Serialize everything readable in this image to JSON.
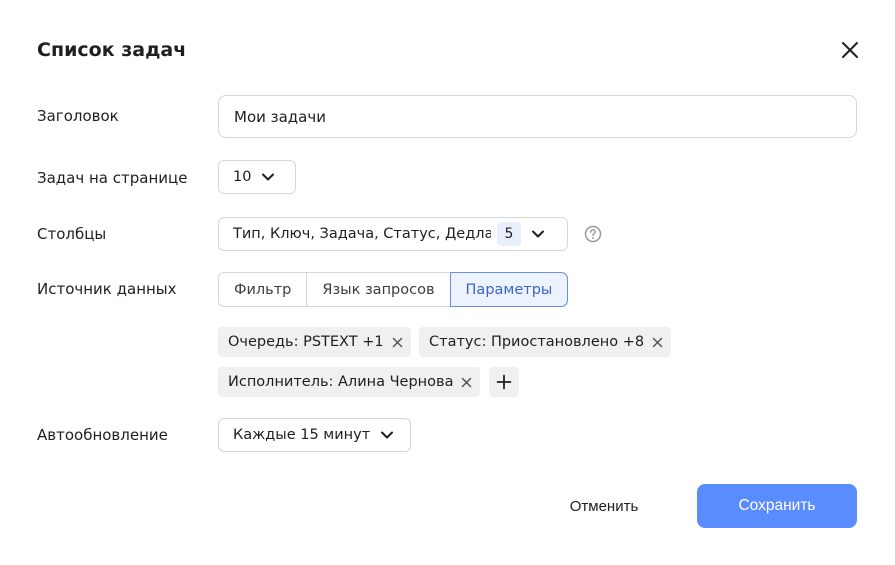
{
  "dialog": {
    "title": "Список задач"
  },
  "fields": {
    "heading": {
      "label": "Заголовок",
      "value": "Мои задачи"
    },
    "per_page": {
      "label": "Задач на странице",
      "value": "10"
    },
    "columns": {
      "label": "Столбцы",
      "value": "Тип, Ключ, Задача, Статус, Дедлайн",
      "count": "5"
    },
    "source": {
      "label": "Источник данных",
      "tabs": [
        {
          "label": "Фильтр",
          "active": false
        },
        {
          "label": "Язык запросов",
          "active": false
        },
        {
          "label": "Параметры",
          "active": true
        }
      ],
      "chips": [
        {
          "label": "Очередь: PSTEXT +1"
        },
        {
          "label": "Статус: Приостановлено +8"
        },
        {
          "label": "Исполнитель: Алина Чернова"
        }
      ]
    },
    "autorefresh": {
      "label": "Автообновление",
      "value": "Каждые 15 минут"
    }
  },
  "actions": {
    "cancel": "Отменить",
    "save": "Сохранить"
  },
  "colors": {
    "accent": "#5b8cff",
    "active_tab_text": "#3d63c7",
    "chip_bg": "#f0f0f0"
  }
}
